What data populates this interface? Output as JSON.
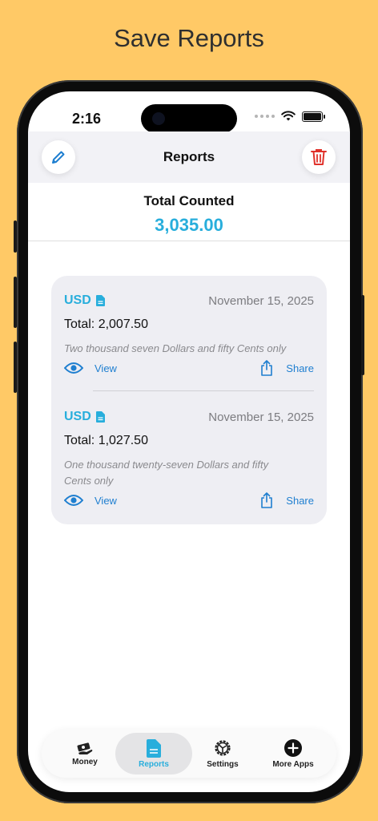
{
  "headline": "Save Reports",
  "status": {
    "time": "2:16"
  },
  "nav": {
    "title": "Reports"
  },
  "summary": {
    "label": "Total Counted",
    "value": "3,035.00"
  },
  "reports": [
    {
      "currency": "USD",
      "date": "November 15, 2025",
      "total": "Total: 2,007.50",
      "words": "Two thousand seven Dollars and fifty Cents only",
      "view_label": "View",
      "share_label": "Share"
    },
    {
      "currency": "USD",
      "date": "November 15, 2025",
      "total": "Total: 1,027.50",
      "words": "One thousand twenty-seven Dollars and fifty Cents only",
      "view_label": "View",
      "share_label": "Share"
    }
  ],
  "tabs": [
    {
      "label": "Money",
      "icon": "money-icon",
      "active": false
    },
    {
      "label": "Reports",
      "icon": "document-icon",
      "active": true
    },
    {
      "label": "Settings",
      "icon": "gear-icon",
      "active": false
    },
    {
      "label": "More Apps",
      "icon": "plus-circle-icon",
      "active": false
    }
  ],
  "colors": {
    "background": "#FFC966",
    "accent": "#28AEDC",
    "link": "#1F7FD0",
    "delete": "#E0322B",
    "card": "#EEEEF3"
  }
}
